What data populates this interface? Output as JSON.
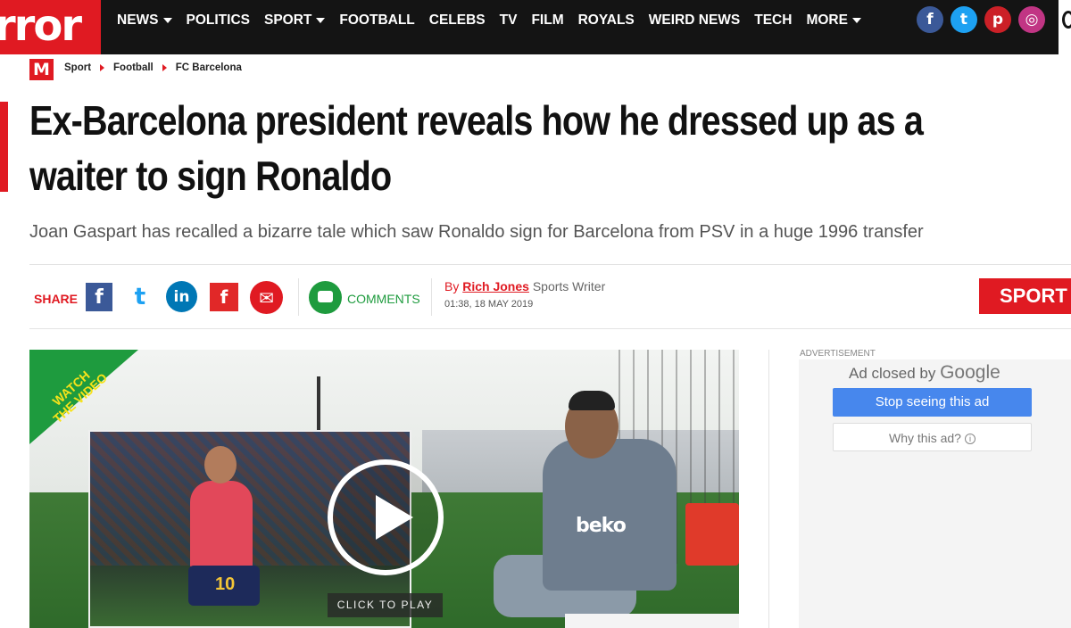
{
  "header": {
    "logo_text": "rror",
    "nav": [
      {
        "label": "NEWS",
        "dropdown": true
      },
      {
        "label": "POLITICS",
        "dropdown": false
      },
      {
        "label": "SPORT",
        "dropdown": true
      },
      {
        "label": "FOOTBALL",
        "dropdown": false
      },
      {
        "label": "CELEBS",
        "dropdown": false
      },
      {
        "label": "TV",
        "dropdown": false
      },
      {
        "label": "FILM",
        "dropdown": false
      },
      {
        "label": "ROYALS",
        "dropdown": false
      },
      {
        "label": "WEIRD NEWS",
        "dropdown": false
      },
      {
        "label": "TECH",
        "dropdown": false
      },
      {
        "label": "MORE",
        "dropdown": true
      }
    ],
    "social": [
      {
        "name": "facebook-icon",
        "glyph": "f",
        "color": "#3b5998"
      },
      {
        "name": "twitter-icon",
        "glyph": "t",
        "color": "#1da1f2"
      },
      {
        "name": "pinterest-icon",
        "glyph": "p",
        "color": "#cb2027"
      },
      {
        "name": "instagram-icon",
        "glyph": "◎",
        "color": "#c13584"
      }
    ]
  },
  "breadcrumb": {
    "logo": "M",
    "items": [
      "Sport",
      "Football",
      "FC Barcelona"
    ]
  },
  "article": {
    "headline": "Ex-Barcelona president reveals how he dressed up as a waiter to sign Ronaldo",
    "standfirst": "Joan Gaspart has recalled a bizarre tale which saw Ronaldo sign for Barcelona from PSV in a huge 1996 transfer",
    "share_label": "SHARE",
    "comments_label": "COMMENTS",
    "byline_prefix": "By",
    "author": "Rich Jones",
    "author_role": "Sports Writer",
    "date": "01:38, 18 MAY 2019",
    "section_tag": "SPORT"
  },
  "share_icons": [
    {
      "name": "facebook-share-icon",
      "glyph": "f",
      "color": "#3b5998"
    },
    {
      "name": "twitter-share-icon",
      "glyph": "t",
      "color": "#1da1f2"
    },
    {
      "name": "linkedin-share-icon",
      "glyph": "in",
      "color": "#0077b5"
    },
    {
      "name": "flipboard-share-icon",
      "glyph": "f",
      "color": "#e12828"
    },
    {
      "name": "email-share-icon",
      "glyph": "✉",
      "color": "#e01a22"
    }
  ],
  "video": {
    "watch_label_line1": "WATCH",
    "watch_label_line2": "THE VIDEO",
    "click_to_play": "CLICK TO PLAY",
    "shirt_text": "beko",
    "shirt_number": "10"
  },
  "ad": {
    "label": "ADVERTISEMENT",
    "closed_by": "Ad closed by",
    "google": "Google",
    "stop_label": "Stop seeing this ad",
    "why_label": "Why this ad?",
    "info_glyph": "i"
  },
  "colors": {
    "brand_red": "#e01a22",
    "nav_bg": "#141414",
    "comments_green": "#1e9b3e",
    "ad_blue": "#4787ed"
  }
}
